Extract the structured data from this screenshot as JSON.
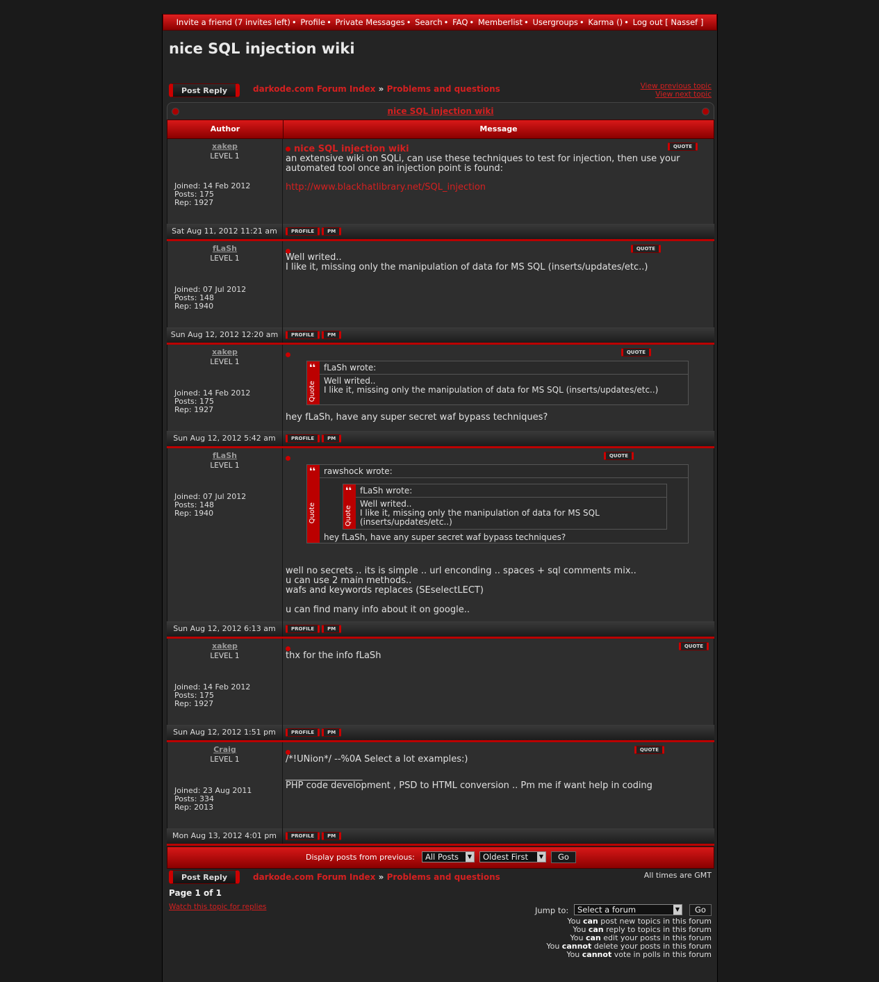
{
  "nav": {
    "items": [
      "Invite a friend (7 invites left)",
      "Profile",
      "Private Messages",
      "Search",
      "FAQ",
      "Memberlist",
      "Usergroups",
      "Karma ()",
      "Log out [ Nassef ]"
    ]
  },
  "topic": {
    "title": "nice SQL injection wiki",
    "post_reply": "Post Reply",
    "crumb_index": "darkode.com Forum Index",
    "crumb_sep": "»",
    "crumb_forum": "Problems and questions",
    "view_prev": "View previous topic",
    "view_next": "View next topic"
  },
  "table": {
    "author_header": "Author",
    "message_header": "Message"
  },
  "buttons": {
    "quote": "QUOTE",
    "profile": "PROFILE",
    "pm": "PM"
  },
  "posts": [
    {
      "user": "xakep",
      "level": "LEVEL 1",
      "joined": "Joined: 14 Feb 2012",
      "posts": "Posts: 175",
      "rep": "Rep: 1927",
      "date": "Sat Aug 11, 2012 11:21 am",
      "subject": "nice SQL injection wiki",
      "line1": "an extensive wiki on SQLi, can use these techniques to test for injection, then use your",
      "line2": "automated tool once an injection point is found:",
      "url": "http://www.blackhatlibrary.net/SQL_injection"
    },
    {
      "user": "fLaSh",
      "level": "LEVEL 1",
      "joined": "Joined: 07 Jul 2012",
      "posts": "Posts: 148",
      "rep": "Rep: 1940",
      "date": "Sun Aug 12, 2012 12:20 am",
      "line1": "Well writed..",
      "line2": "I like it, missing only the manipulation of data for MS SQL (inserts/updates/etc..)"
    },
    {
      "user": "xakep",
      "level": "LEVEL 1",
      "joined": "Joined: 14 Feb 2012",
      "posts": "Posts: 175",
      "rep": "Rep: 1927",
      "date": "Sun Aug 12, 2012 5:42 am",
      "quote_author": "fLaSh wrote:",
      "quote_line1": "Well writed..",
      "quote_line2": "I like it, missing only the manipulation of data for MS SQL (inserts/updates/etc..)",
      "body": "hey fLaSh, have any super secret waf bypass techniques?"
    },
    {
      "user": "fLaSh",
      "level": "LEVEL 1",
      "joined": "Joined: 07 Jul 2012",
      "posts": "Posts: 148",
      "rep": "Rep: 1940",
      "date": "Sun Aug 12, 2012 6:13 am",
      "quote_author": "rawshock wrote:",
      "inner_author": "fLaSh wrote:",
      "inner_line1": "Well writed..",
      "inner_line2": "I like it, missing only the manipulation of data for MS SQL",
      "inner_line3": "(inserts/updates/etc..)",
      "quote_body": "hey fLaSh, have any super secret waf bypass techniques?",
      "line1": "well no secrets .. its is simple .. url enconding .. spaces + sql comments mix..",
      "line2": "u can use 2 main methods..",
      "line3": "wafs and keywords replaces (SEselectLECT)",
      "line4": "u can find many info about it on google.."
    },
    {
      "user": "xakep",
      "level": "LEVEL 1",
      "joined": "Joined: 14 Feb 2012",
      "posts": "Posts: 175",
      "rep": "Rep: 1927",
      "date": "Sun Aug 12, 2012 1:51 pm",
      "line1": "thx for the info fLaSh"
    },
    {
      "user": "Craig",
      "level": "LEVEL 1",
      "joined": "Joined: 23 Aug 2011",
      "posts": "Posts: 334",
      "rep": "Rep: 2013",
      "date": "Mon Aug 13, 2012 4:01 pm",
      "line1": "/*!UNion*/ --%0A Select a lot examples:)",
      "sig_rule": "_________________",
      "sig": "PHP code development , PSD to HTML conversion .. Pm me if want help in coding"
    }
  ],
  "display": {
    "label": "Display posts from previous:",
    "range": "All Posts",
    "order": "Oldest First",
    "go": "Go"
  },
  "bottom": {
    "timezone": "All times are GMT",
    "page": "Page 1 of 1",
    "watch": "Watch this topic for replies",
    "jump_label": "Jump to:",
    "jump_value": "Select a forum",
    "jump_go": "Go"
  },
  "permissions": [
    {
      "pre": "You ",
      "b": "can",
      "post": " post new topics in this forum"
    },
    {
      "pre": "You ",
      "b": "can",
      "post": " reply to topics in this forum"
    },
    {
      "pre": "You ",
      "b": "can",
      "post": " edit your posts in this forum"
    },
    {
      "pre": "You ",
      "b": "cannot",
      "post": " delete your posts in this forum"
    },
    {
      "pre": "You ",
      "b": "cannot",
      "post": " vote in polls in this forum"
    }
  ]
}
